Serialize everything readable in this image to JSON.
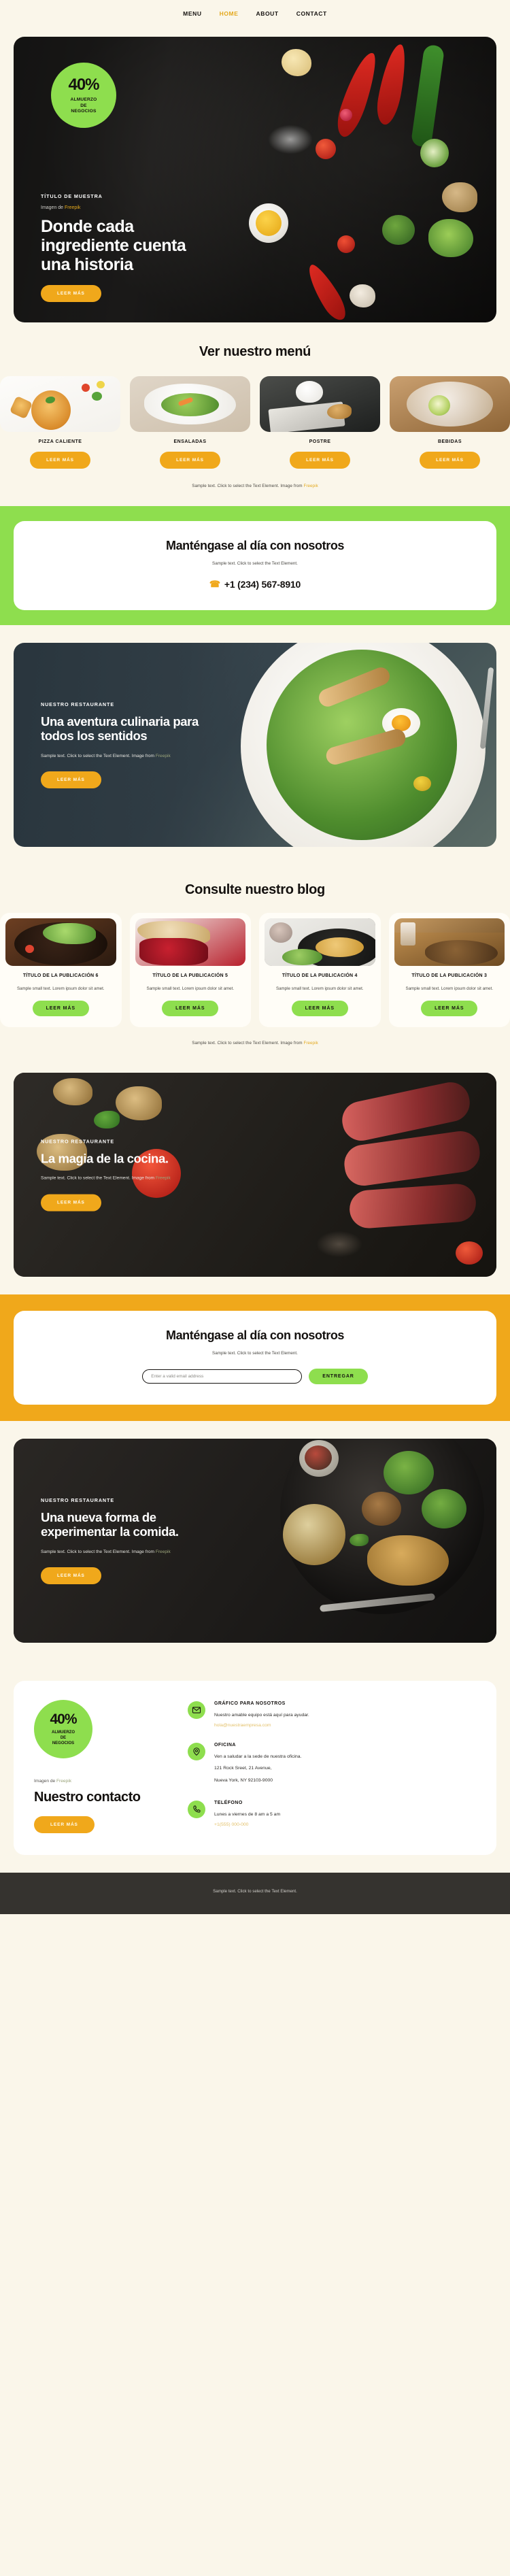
{
  "nav": {
    "items": [
      {
        "label": "MENU",
        "active": false
      },
      {
        "label": "HOME",
        "active": true
      },
      {
        "label": "ABOUT",
        "active": false
      },
      {
        "label": "CONTACT",
        "active": false
      }
    ]
  },
  "hero": {
    "badge": {
      "percent": "40%",
      "line1": "ALMUERZO",
      "line2": "DE",
      "line3": "NEGOCIOS"
    },
    "eyebrow": "TÍTULO DE MUESTRA",
    "credit_prefix": "Imagen de ",
    "credit_link": "Freepik",
    "title": "Donde cada ingrediente cuenta una historia",
    "cta": "LEER MÁS"
  },
  "menu": {
    "title": "Ver nuestro menú",
    "cards": [
      {
        "label": "PIZZA CALIENTE",
        "cta": "LEER MÁS"
      },
      {
        "label": "ENSALADAS",
        "cta": "LEER MÁS"
      },
      {
        "label": "POSTRE",
        "cta": "LEER MÁS"
      },
      {
        "label": "BEBIDAS",
        "cta": "LEER MÁS"
      }
    ],
    "note_prefix": "Sample text. Click to select the Text Element. Image from ",
    "note_link": "Freepik"
  },
  "newsletter_green": {
    "title": "Manténgase al día con nosotros",
    "subtitle": "Sample text. Click to select the Text Element.",
    "phone": "+1 (234) 567-8910"
  },
  "feature_salad": {
    "eyebrow": "NUESTRO RESTAURANTE",
    "title": "Una aventura culinaria para todos los sentidos",
    "text_prefix": "Sample text. Click to select the Text Element. Image from ",
    "text_link": "Freepik",
    "cta": "LEER MÁS"
  },
  "blog": {
    "title": "Consulte nuestro blog",
    "cards": [
      {
        "title": "TÍTULO DE LA PUBLICACIÓN 6",
        "text": "Sample small text. Lorem ipsum dolor sit amet.",
        "cta": "LEER MÁS"
      },
      {
        "title": "TÍTULO DE LA PUBLICACIÓN 5",
        "text": "Sample small text. Lorem ipsum dolor sit amet.",
        "cta": "LEER MÁS"
      },
      {
        "title": "TÍTULO DE LA PUBLICACIÓN 4",
        "text": "Sample small text. Lorem ipsum dolor sit amet.",
        "cta": "LEER MÁS"
      },
      {
        "title": "TÍTULO DE LA PUBLICACIÓN 3",
        "text": "Sample small text. Lorem ipsum dolor sit amet.",
        "cta": "LEER MÁS"
      }
    ],
    "note_prefix": "Sample text. Click to select the Text Element. Image from ",
    "note_link": "Freepik"
  },
  "feature_steak": {
    "eyebrow": "NUESTRO RESTAURANTE",
    "title": "La magia de la cocina.",
    "text_prefix": "Sample text. Click to select the Text Element. Image from ",
    "text_link": "Freepik",
    "cta": "LEER MÁS"
  },
  "newsletter_yellow": {
    "title": "Manténgase al día con nosotros",
    "subtitle": "Sample text. Click to select the Text Element.",
    "email_placeholder": "Enter a valid email address",
    "submit": "ENTREGAR"
  },
  "feature_broccoli": {
    "eyebrow": "NUESTRO RESTAURANTE",
    "title": "Una nueva forma de experimentar la comida.",
    "text_prefix": "Sample text. Click to select the Text Element. Image from ",
    "text_link": "Freepik",
    "cta": "LEER MÁS"
  },
  "contact": {
    "badge": {
      "percent": "40%",
      "line1": "ALMUERZO",
      "line2": "DE",
      "line3": "NEGOCIOS"
    },
    "credit_prefix": "Imagen de ",
    "credit_link": "Freepik",
    "title": "Nuestro contacto",
    "cta": "LEER MÁS",
    "items": [
      {
        "icon": "envelope-icon",
        "title": "GRÁFICO PARA NOSOTROS",
        "desc": "Nuestro amable equipo está aquí para ayudar.",
        "link": "hola@nuestraempresa.com",
        "addr1": "",
        "addr2": ""
      },
      {
        "icon": "location-pin-icon",
        "title": "OFICINA",
        "desc": "Ven a saludar a la sede de nuestra oficina.",
        "link": "",
        "addr1": "121 Rock Sreet, 21 Avenue,",
        "addr2": "Nueva York, NY 92103-9000"
      },
      {
        "icon": "phone-icon",
        "title": "TELÉFONO",
        "desc": "Lunes a viernes de 8 am a 5 am",
        "link": "+1(555) 000-000",
        "addr1": "",
        "addr2": ""
      }
    ]
  },
  "footer": {
    "text": "Sample text. Click to select the Text Element."
  },
  "colors": {
    "page_bg": "#faf6ea",
    "green": "#8ede4e",
    "yellow": "#f0a81b",
    "accent_text": "#e3a81c",
    "dark": "#14110f",
    "footer_bg": "#35332f"
  }
}
